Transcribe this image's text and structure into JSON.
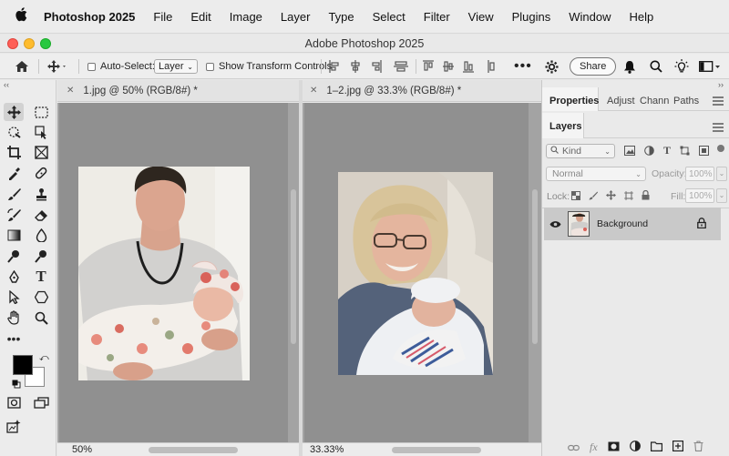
{
  "menubar": {
    "items": [
      "Photoshop 2025",
      "File",
      "Edit",
      "Image",
      "Layer",
      "Type",
      "Select",
      "Filter",
      "View",
      "Plugins",
      "Window",
      "Help"
    ]
  },
  "window": {
    "title": "Adobe Photoshop 2025"
  },
  "options": {
    "auto_select_label": "Auto-Select:",
    "auto_select_value": "Layer",
    "show_transform_label": "Show Transform Controls",
    "share_label": "Share"
  },
  "documents": [
    {
      "tab": "1.jpg @ 50% (RGB/8#) *",
      "zoom": "50%"
    },
    {
      "tab": "1–2.jpg @ 33.3% (RGB/8#) *",
      "zoom": "33.33%"
    }
  ],
  "panels": {
    "tabs": [
      "Properties",
      "Adjust",
      "Chann",
      "Paths"
    ],
    "layers_tab": "Layers",
    "filter_kind": "Kind",
    "blend_mode": "Normal",
    "opacity_label": "Opacity:",
    "opacity_value": "100%",
    "lock_label": "Lock:",
    "fill_label": "Fill:",
    "fill_value": "100%",
    "layer_name": "Background"
  },
  "colors": {
    "foreground": "#000000",
    "background": "#ffffff",
    "canvas": "#909090"
  }
}
